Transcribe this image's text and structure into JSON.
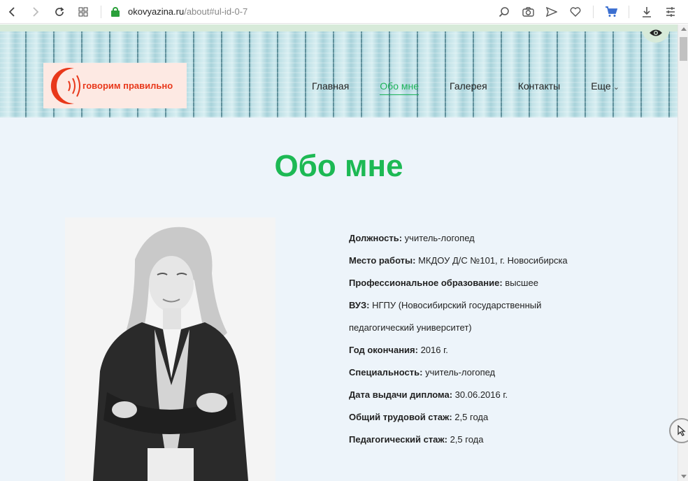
{
  "browser": {
    "url_domain": "okovyazina.ru",
    "url_path": "/about#ul-id-0-7",
    "icons": [
      "back-icon",
      "forward-icon",
      "reload-icon",
      "tabs-grid-icon",
      "lock-icon",
      "search-icon",
      "camera-icon",
      "send-icon",
      "heart-icon",
      "cart-icon",
      "download-icon",
      "menu-icon"
    ]
  },
  "site": {
    "logo_text": "говорим правильно",
    "nav": [
      {
        "label": "Главная"
      },
      {
        "label": "Обо мне"
      },
      {
        "label": "Галерея"
      },
      {
        "label": "Контакты"
      },
      {
        "label": "Еще"
      }
    ],
    "active_nav": "Обо мне",
    "accent_color": "#1db954"
  },
  "main": {
    "title": "Обо мне",
    "details": [
      {
        "key": "Должность:",
        "value": " учитель-логопед"
      },
      {
        "key": "Место работы:",
        "value": " МКДОУ Д/С №101, г. Новосибирска"
      },
      {
        "key": "Профессиональное образование:",
        "value": " высшее"
      },
      {
        "key": "ВУЗ:",
        "value": " НГПУ (Новосибирский государственный"
      },
      {
        "key": "",
        "value": "педагогический университет)"
      },
      {
        "key": "Год окончания:",
        "value": " 2016 г."
      },
      {
        "key": "Специальность:",
        "value": " учитель-логопед"
      },
      {
        "key": "Дата выдачи диплома:",
        "value": " 30.06.2016 г."
      },
      {
        "key": "Общий трудовой стаж:",
        "value": " 2,5 года"
      },
      {
        "key": "Педагогический стаж:",
        "value": " 2,5 года"
      }
    ]
  }
}
